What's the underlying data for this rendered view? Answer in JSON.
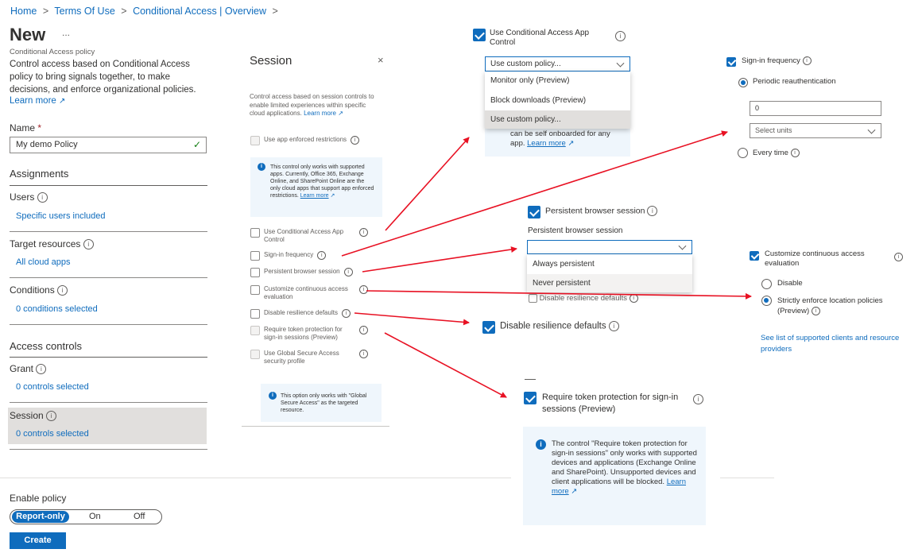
{
  "breadcrumb": {
    "home": "Home",
    "terms": "Terms Of Use",
    "ca": "Conditional Access | Overview",
    "sep": ">"
  },
  "page": {
    "title": "New",
    "more": "...",
    "subtitle": "Conditional Access policy",
    "description": "Control access based on Conditional Access policy to bring signals together, to make decisions, and enforce organizational policies.",
    "learn_more": "Learn more"
  },
  "name_field": {
    "label": "Name",
    "required": "*",
    "value": "My demo Policy"
  },
  "assignments": {
    "heading": "Assignments",
    "users_label": "Users",
    "users_value": "Specific users included",
    "target_label": "Target resources",
    "target_value": "All cloud apps",
    "conditions_label": "Conditions",
    "conditions_value": "0 conditions selected"
  },
  "access_controls": {
    "heading": "Access controls",
    "grant_label": "Grant",
    "grant_value": "0 controls selected",
    "session_label": "Session",
    "session_value": "0 controls selected"
  },
  "enable_policy": {
    "label": "Enable policy",
    "options": [
      "Report-only",
      "On",
      "Off"
    ],
    "selected": "Report-only"
  },
  "create_button": "Create",
  "session_pane": {
    "title": "Session",
    "close": "×",
    "description": "Control access based on session controls to enable limited experiences within specific cloud applications.",
    "learn_more": "Learn more",
    "app_enforced": "Use app enforced restrictions",
    "info1": "This control only works with supported apps. Currently, Office 365, Exchange Online, and SharePoint Online are the only cloud apps that support app enforced restrictions.",
    "info1_link": "Learn more",
    "items": [
      "Use Conditional Access App Control",
      "Sign-in frequency",
      "Persistent browser session",
      "Customize continuous access evaluation",
      "Disable resilience defaults",
      "Require token protection for sign-in sessions (Preview)",
      "Use Global Secure Access security profile"
    ],
    "info2": "This option only works with \"Global Secure Access\" as the targeted resource."
  },
  "caac": {
    "label": "Use Conditional Access App Control",
    "dropdown_value": "Use custom policy...",
    "options": [
      "Monitor only (Preview)",
      "Block downloads (Preview)",
      "Use custom policy..."
    ],
    "hidden_text": "can be self onboarded for any app.",
    "hidden_link": "Learn more"
  },
  "sif": {
    "label": "Sign-in frequency",
    "periodic": "Periodic reauthentication",
    "value": "0",
    "units_placeholder": "Select units",
    "every_time": "Every time"
  },
  "pbs": {
    "label": "Persistent browser session",
    "field_label": "Persistent browser session",
    "options": [
      "Always persistent",
      "Never persistent"
    ],
    "behind": "Disable resilience defaults"
  },
  "cae": {
    "label": "Customize continuous access evaluation",
    "disable": "Disable",
    "strict": "Strictly enforce location policies (Preview)",
    "link": "See list of supported clients and resource providers"
  },
  "drd": {
    "label": "Disable resilience defaults"
  },
  "tp": {
    "label": "Require token protection for sign-in sessions (Preview)",
    "info": "The control \"Require token protection for sign-in sessions\" only works with supported devices and applications (Exchange Online and SharePoint). Unsupported devices and client applications will be blocked.",
    "link": "Learn more"
  },
  "colors": {
    "accent": "#0f6cbd",
    "arrow": "#e81123",
    "info_bg": "#eff6fc",
    "selected_nav": "#e1dfdd"
  }
}
